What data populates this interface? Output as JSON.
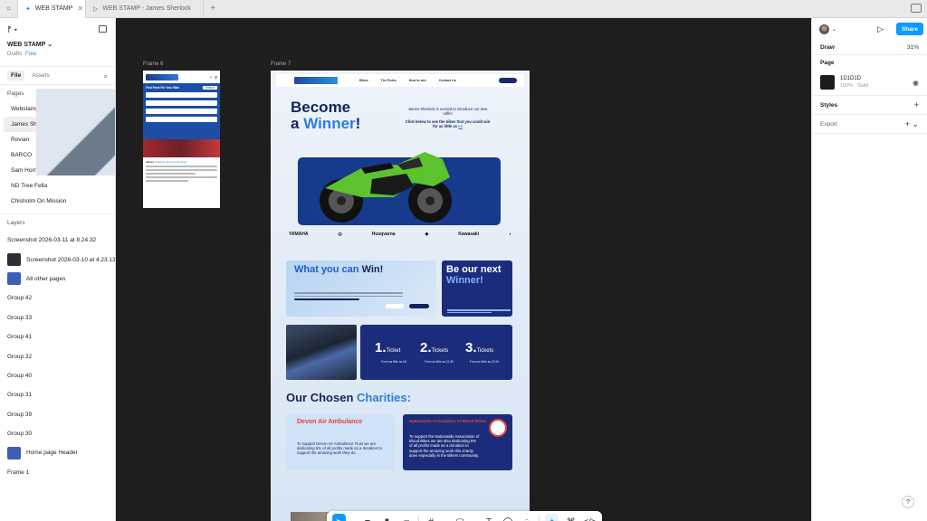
{
  "tabs": [
    {
      "label": "WEB STAMP",
      "active": true
    },
    {
      "label": "WEB STAMP - James Sherlock",
      "active": false
    }
  ],
  "left_panel": {
    "file_title": "WEB STAMP",
    "drafts": "Drafts",
    "plan": "Free",
    "tab_file": "File",
    "tab_assets": "Assets",
    "pages_header": "Pages",
    "pages": [
      "Webstamp",
      "James Sherlock",
      "Rovian",
      "BARCO",
      "Sam Horn",
      "ND Tree Fella",
      "Chisholm On Mission"
    ],
    "selected_page": "James Sherlock",
    "layers_header": "Layers",
    "layers": [
      {
        "name": "Screenshot 2026-03-11 at 8.24.32",
        "thumb": "moto"
      },
      {
        "name": "Screenshot 2026-03-10 at 4.23.13",
        "thumb": "dark"
      },
      {
        "name": "All other pages",
        "thumb": "blue"
      },
      {
        "name": "Group 42",
        "thumb": "moto"
      },
      {
        "name": "Group 33",
        "thumb": "moto"
      },
      {
        "name": "Group 41",
        "thumb": "moto"
      },
      {
        "name": "Group 32",
        "thumb": "moto"
      },
      {
        "name": "Group 40",
        "thumb": "moto"
      },
      {
        "name": "Group 31",
        "thumb": "moto"
      },
      {
        "name": "Group 39",
        "thumb": "moto"
      },
      {
        "name": "Group 30",
        "thumb": "moto"
      },
      {
        "name": "Home page Header",
        "thumb": "blue"
      },
      {
        "name": "Frame 1",
        "thumb": "moto"
      }
    ]
  },
  "canvas": {
    "frame6_label": "Frame 6",
    "frame7_label": "Frame 7",
    "frame6": {
      "find": "Find Parts For Your Bike",
      "search": "Search",
      "heading_a": "James",
      "heading_b": "Sherlock Motorcycle Parts"
    },
    "frame7": {
      "nav_links": [
        "Bikes",
        "The Rules",
        "How to win",
        "Contact Us"
      ],
      "hero_line1": "Become",
      "hero_a": "a ",
      "hero_win": "Winner",
      "hero_bang": "!",
      "hero_text": "James Sherlock is excited to introduce our new raffle!",
      "hero_text2": "Click below to see the bikes that you could win for as little as ",
      "hero_price": "£8",
      "brands": [
        "YAMAHA",
        "Husqvarna",
        "Kawasaki"
      ],
      "card1_title_a": "What you can ",
      "card1_title_b": "Win!",
      "card2_title_a": "Be our next",
      "card2_title_b": "Winner!",
      "tickets": [
        {
          "num": "1.",
          "word": "Ticket",
          "sub": "From as little as £8"
        },
        {
          "num": "2.",
          "word": "Tickets",
          "sub": "From as little as £1.80"
        },
        {
          "num": "3.",
          "word": "Tickets",
          "sub": "From as little as £2.60"
        }
      ],
      "charities_a": "Our Chosen ",
      "charities_b": "Charities:",
      "charity1_name": "Devon Air Ambulance",
      "charity1_text": "To support Devon Air Ambulance Trust we are dedicating 5% of all profits made as a donation to support the amazing work they do.",
      "charity2_name": "Nationwide Association of Blood Bikes",
      "charity2_text": "To support the Nationwide Association of Blood Bikes we are also dedicating 5% of all profits made as a donation to support the amazing work this charity does especially in the Bikers community."
    }
  },
  "right_panel": {
    "draw": "Draw",
    "zoom": "31%",
    "share": "Share",
    "page_header": "Page",
    "page_color": "1D1D1D",
    "page_opacity": "100%",
    "page_opacity_label": "Solid",
    "styles": "Styles",
    "export": "Export",
    "help": "?"
  },
  "colors": {
    "accent": "#0d99ff",
    "canvas_bg": "#1e1e1e",
    "brand_navy": "#15235a",
    "brand_blue": "#2b7de0"
  }
}
